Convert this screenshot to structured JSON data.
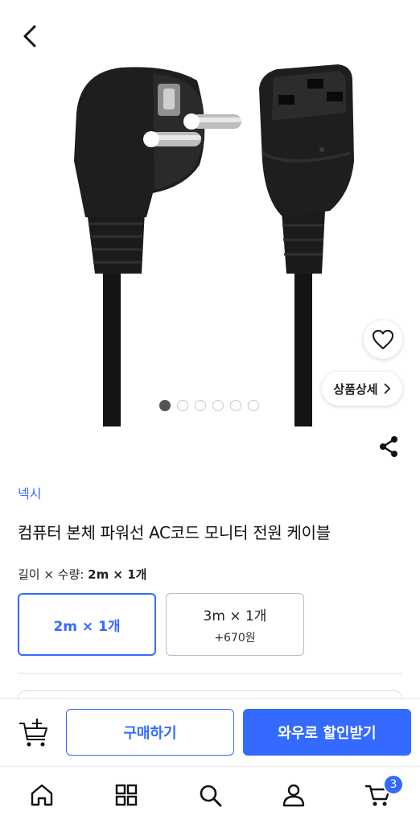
{
  "header": {
    "back_icon": "chevron-left-icon"
  },
  "gallery": {
    "image_alt": "product-photo-power-cable",
    "dot_count": 6,
    "active_index": 0,
    "wishlist_icon": "heart-outline-icon",
    "detail_label": "상품상세",
    "detail_icon": "chevron-right-icon"
  },
  "share_icon": "share-icon",
  "product": {
    "brand": "넥시",
    "title": "컴퓨터 본체 파워선 AC코드 모니터 전원 케이블"
  },
  "options": {
    "label_prefix": "길이 × 수량:",
    "selected_value": "2m × 1개",
    "items": [
      {
        "label": "2m × 1개",
        "extra": ""
      },
      {
        "label": "3m × 1개",
        "extra": "+670원"
      }
    ]
  },
  "actions": {
    "cart_add_icon": "cart-add-icon",
    "buy_label": "구매하기",
    "wow_label": "와우로 할인받기"
  },
  "tabbar": {
    "items": [
      "home-icon",
      "categories-icon",
      "search-icon",
      "my-page-icon",
      "cart-icon"
    ],
    "cart_badge": "3"
  },
  "colors": {
    "accent": "#346aff",
    "text": "#111111",
    "border": "#bdbdbd"
  }
}
